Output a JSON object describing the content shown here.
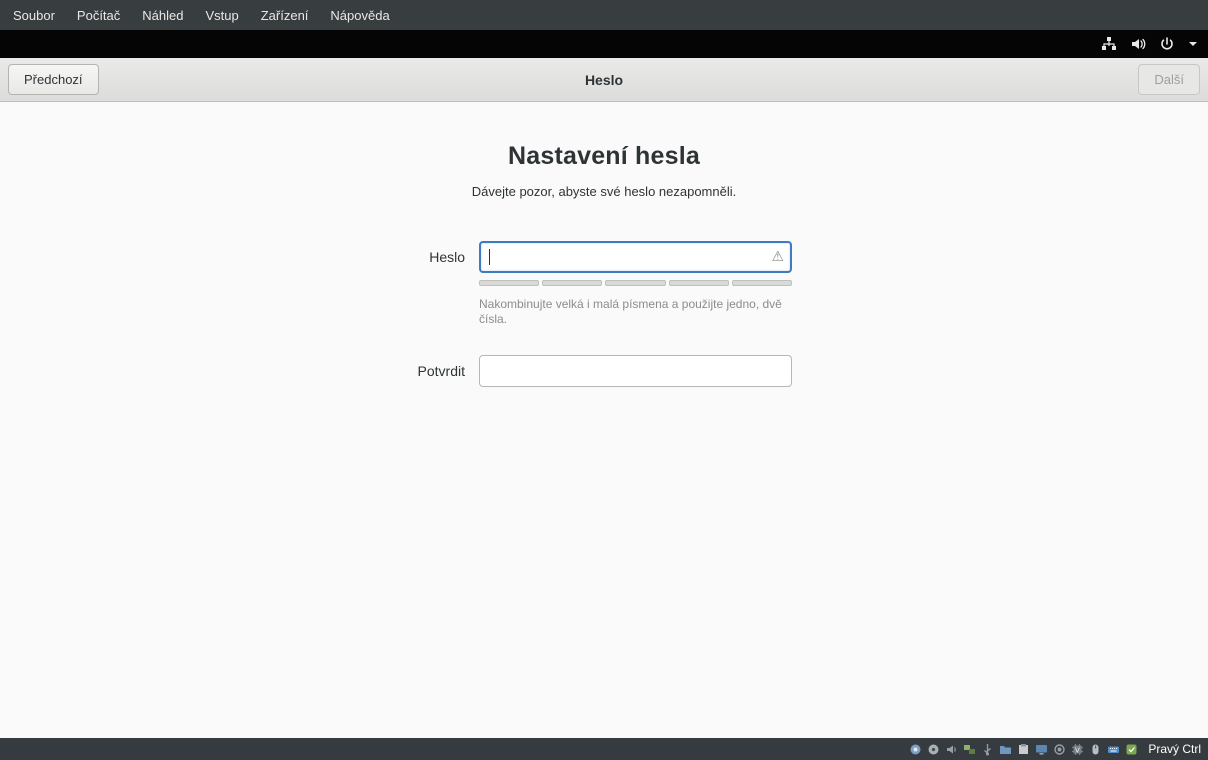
{
  "vbox_menu": {
    "items": [
      "Soubor",
      "Počítač",
      "Náhled",
      "Vstup",
      "Zařízení",
      "Nápověda"
    ]
  },
  "gnome_topbar": {
    "icons": [
      "network-icon",
      "volume-icon",
      "power-icon",
      "chevron-down-icon"
    ]
  },
  "header": {
    "back_label": "Předchozí",
    "title": "Heslo",
    "next_label": "Další"
  },
  "main": {
    "title": "Nastavení hesla",
    "subtitle": "Dávejte pozor, abyste své heslo nezapomněli.",
    "password": {
      "label": "Heslo",
      "value": "",
      "placeholder": "",
      "hint": "Nakombinujte velká i malá písmena a použijte jedno, dvě čísla.",
      "strength_segments": 5,
      "warning_icon": "warning-icon"
    },
    "confirm": {
      "label": "Potvrdit",
      "value": "",
      "placeholder": ""
    }
  },
  "statusbar": {
    "icons": [
      "hdd-icon",
      "cd-icon",
      "audio-icon",
      "network-icon",
      "usb-icon",
      "shared-folders-icon",
      "clipboard-icon",
      "display-icon",
      "recording-icon",
      "features-icon",
      "mouse-icon",
      "keyboard-icon",
      "host-state-icon"
    ],
    "host_key": "Pravý Ctrl"
  },
  "colors": {
    "focus_border": "#3e7bbf",
    "menubar_bg": "#383d3f",
    "topbar_bg": "#050505",
    "statusbar_bg": "#353b3e"
  }
}
